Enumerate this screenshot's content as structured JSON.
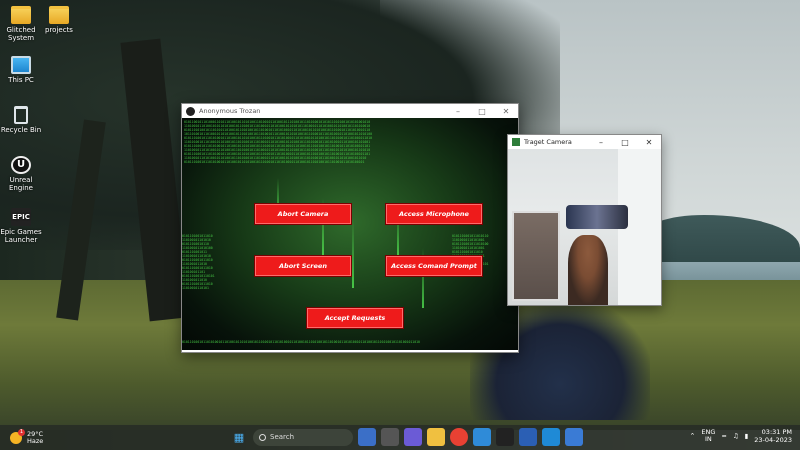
{
  "desktop_icons": [
    {
      "label_line1": "Glitched",
      "label_line2": "System"
    },
    {
      "label_line1": "projects",
      "label_line2": ""
    },
    {
      "label_line1": "This PC",
      "label_line2": ""
    },
    {
      "label_line1": "Recycle Bin",
      "label_line2": ""
    },
    {
      "label_line1": "Unreal",
      "label_line2": "Engine"
    },
    {
      "label_line1": "Epic Games",
      "label_line2": "Launcher"
    }
  ],
  "main_window": {
    "title": "Anonymous Trozan",
    "buttons": {
      "abort_camera": "Abort Camera",
      "access_microphone": "Access Microphone",
      "abort_screen": "Abort Screen",
      "access_cmd": "Access Comand Prompt",
      "accept_requests": "Accept Requests"
    }
  },
  "camera_window": {
    "title": "Traget Camera"
  },
  "taskbar": {
    "weather_temp": "29°C",
    "weather_desc": "Haze",
    "weather_badge": "1",
    "search_label": "Search",
    "lang_line1": "ENG",
    "lang_line2": "IN",
    "time": "03:31 PM",
    "date": "23-04-2023"
  },
  "icons": [
    "folder-icon",
    "pc-icon",
    "recycle-bin-icon",
    "unreal-icon",
    "epic-icon",
    "windows-start-icon",
    "search-icon",
    "wifi-icon",
    "volume-icon",
    "battery-icon"
  ]
}
